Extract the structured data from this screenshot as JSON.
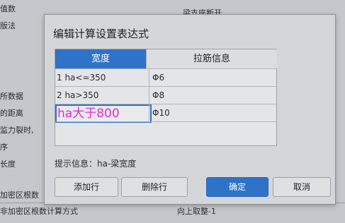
{
  "background": {
    "left_rows": [
      "值数",
      "版法",
      "",
      "",
      "",
      "",
      "所数据",
      "的距离",
      "监力裂时,",
      "序",
      "长度",
      "",
      "加密区根数",
      "非加密区根数计算方式"
    ],
    "top_right_text": "梁支座断开",
    "bottom_value": "向上取整-1"
  },
  "dialog": {
    "title": "编辑计算设置表达式",
    "table": {
      "header_width": "宽度",
      "header_rebar": "拉筋信息",
      "rows": [
        {
          "cond": "1 ha<=350",
          "rebar": "Φ6"
        },
        {
          "cond": "2 ha>350",
          "rebar": "Φ8"
        },
        {
          "cond": "",
          "rebar": "Φ10"
        }
      ],
      "editing_text": "ha大于800"
    },
    "hint": "提示信息：ha-梁宽度",
    "buttons": {
      "add": "添加行",
      "delete": "删除行",
      "ok": "确定",
      "cancel": "取消"
    }
  },
  "colors": {
    "accent": "#2f73c9",
    "editing_text": "#e02bd0"
  }
}
